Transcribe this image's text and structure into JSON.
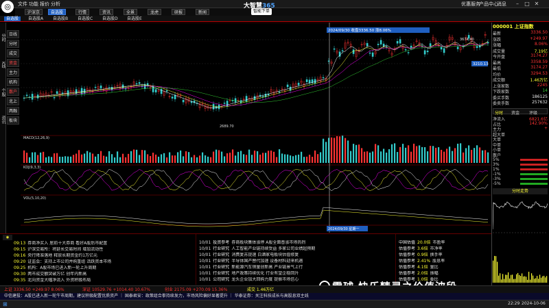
{
  "app": {
    "brand_text": "大智慧",
    "brand_num": "365",
    "menu": [
      "文件",
      "功能",
      "报价",
      "分析"
    ],
    "right_menu": [
      "优惠服务",
      "产品中心",
      "消息"
    ]
  },
  "toolbar2": [
    {
      "label": "沪深京",
      "active": false
    },
    {
      "label": "自选股",
      "active": true
    },
    {
      "label": "行情",
      "active": false
    },
    {
      "label": "资讯",
      "active": false
    },
    {
      "label": "全景",
      "active": false
    },
    {
      "label": "龙虎",
      "active": false
    },
    {
      "label": "研报",
      "active": false
    },
    {
      "label": "新闻",
      "active": false
    }
  ],
  "smart_button": "智能下单",
  "tabs3": [
    {
      "label": "自选股",
      "active": true
    },
    {
      "label": "自选股A",
      "active": false
    },
    {
      "label": "自选股B",
      "active": false
    },
    {
      "label": "自选股C",
      "active": false
    },
    {
      "label": "自选股D",
      "active": false
    },
    {
      "label": "自选股E",
      "active": false
    }
  ],
  "sidebar": [
    "分时",
    "K线",
    "个股",
    "资讯"
  ],
  "indicator_labels": [
    {
      "label": "日线",
      "red": false
    },
    {
      "label": "分时",
      "red": false
    },
    {
      "label": "成交",
      "red": false
    },
    {
      "label": "资金",
      "red": true
    },
    {
      "label": "主力",
      "red": false
    },
    {
      "label": "机构",
      "red": false
    },
    {
      "label": "散户",
      "red": true
    },
    {
      "label": "北上",
      "red": false
    },
    {
      "label": "两融",
      "red": false
    },
    {
      "label": "板块",
      "red": false
    }
  ],
  "chart": {
    "crosshair_label": "2024/09/30 星期一",
    "tooltip": "2024/09/30 收盘3336.50 涨8.06%",
    "price_high": "3674.40",
    "price_marker": "3210.13",
    "price_low": "2689.70",
    "macd_label": "MACD(12,26,9)",
    "kdj_label": "KDJ(9,3,3)",
    "vol_label": "VOL(5,10,20)"
  },
  "rpanel": {
    "title": "000001 上证指数",
    "rows": [
      {
        "k": "最新",
        "v": "3336.50",
        "c": "red"
      },
      {
        "k": "涨跌",
        "v": "+249.97",
        "c": "red"
      },
      {
        "k": "涨幅",
        "v": "8.06%",
        "c": "red"
      },
      {
        "k": "成交量",
        "v": "7.19亿",
        "c": "yellow"
      },
      {
        "k": "今开盘",
        "v": "3174.27",
        "c": "red"
      },
      {
        "k": "最高",
        "v": "3358.59",
        "c": "red"
      },
      {
        "k": "最低",
        "v": "3174.27",
        "c": "red"
      },
      {
        "k": "均价",
        "v": "3294.53",
        "c": "red"
      },
      {
        "k": "成交额",
        "v": "1.46万亿",
        "c": "yellow"
      },
      {
        "k": "上涨家数",
        "v": "2245",
        "c": "red"
      },
      {
        "k": "下跌家数",
        "v": "14",
        "c": "green"
      },
      {
        "k": "委买手数",
        "v": "186125",
        "c": "white"
      },
      {
        "k": "委卖手数",
        "v": "257632",
        "c": "white"
      }
    ],
    "tabs": [
      "分时",
      "资金",
      "评级"
    ],
    "sub_rows": [
      {
        "k": "净流入",
        "v": "6821.6亿",
        "c": "red"
      },
      {
        "k": "占比",
        "v": "142.90%",
        "c": "red"
      },
      {
        "k": "主力",
        "v": "+",
        "c": "red"
      },
      {
        "k": "超大单",
        "v": "",
        "c": "red"
      },
      {
        "k": "大单",
        "v": "",
        "c": "red"
      },
      {
        "k": "中单",
        "v": "",
        "c": "green"
      },
      {
        "k": "小单",
        "v": "",
        "c": "green"
      },
      {
        "k": "散户",
        "v": "",
        "c": "green"
      }
    ],
    "pct_rows": [
      "5%",
      "3%",
      "1%",
      "-1%",
      "-3%",
      "-5%"
    ],
    "mini_chart_label": "分时走势"
  },
  "news_left": [
    {
      "t": "09:13",
      "text": "券商净买入 居前十大券商 看好A股后市配置"
    },
    {
      "t": "09:15",
      "text": "沪深交易所：将延长交易时间 增加流动性"
    },
    {
      "t": "09:16",
      "text": "央行降准落地 释放长期资金约1万亿元"
    },
    {
      "t": "09:20",
      "text": "证监会：支持上市公司并购重组 活跃资本市场"
    },
    {
      "t": "09:25",
      "text": "机构：A股市场已进入新一轮上升周期"
    },
    {
      "t": "09:30",
      "text": "两市成交额突破万亿 创年内新高"
    },
    {
      "t": "09:35",
      "text": "北向资金大幅净流入 外资积极布局"
    }
  ],
  "news_right": [
    {
      "t": "10/01",
      "c": "投资参考",
      "text": "券商板块集体涨停 A股全面普涨市场热烈"
    },
    {
      "t": "10/01",
      "c": "行业研究",
      "text": "人工智能产业链持续受益 多家公司业绩超预期"
    },
    {
      "t": "10/01",
      "c": "行业研究",
      "text": "消费复苏提速 白酒家电板块估值修复"
    },
    {
      "t": "10/01",
      "c": "行业研究",
      "text": "半导体国产替代加速 设备材料迎来机遇"
    },
    {
      "t": "10/01",
      "c": "行业研究",
      "text": "新能源汽车销量创新高 产业链景气上行"
    },
    {
      "t": "10/01",
      "c": "行业研究",
      "text": "地产政策持续优化 行业有望企稳回升"
    },
    {
      "t": "10/01",
      "c": "公司研究",
      "text": "龙头企业加大回购力度 提振市场信心"
    }
  ],
  "news_mid": [
    {
      "k": "20.0倍",
      "v": "市盈率"
    },
    {
      "k": "3.6倍",
      "v": "市净率"
    },
    {
      "k": "0.9倍",
      "v": "换手率"
    },
    {
      "k": "2.41%",
      "v": "股息率"
    },
    {
      "k": "4.1倍",
      "v": "量比"
    },
    {
      "k": "2.0倍",
      "v": "振幅"
    },
    {
      "k": "1.0倍",
      "v": "委比"
    }
  ],
  "news_mid_titles": [
    "中国估值",
    "估值参考",
    "估值参考",
    "估值参考",
    "估值参考",
    "估值参考",
    "估值参考"
  ],
  "status": {
    "sh": "上证 3336.50 +249.97 8.06%",
    "sz": "深证 10529.76 +1014.40 10.67%",
    "cy": "创业 2175.09 +270.09 15.36%",
    "vol": "成交 1.46万亿"
  },
  "ticker": "中信建投：A股已进入新一轮牛市周期，建议积极配置优质资产 ｜ 国泰君安：政策组合拳持续发力，市场风险偏好显著提升 ｜ 华泰证券：关注科技成长与高股息双主线",
  "watermark": "快乐精灵之价值波段",
  "watermark_prefix": "雪球",
  "time": "2024-10-06",
  "clock": "22:29"
}
